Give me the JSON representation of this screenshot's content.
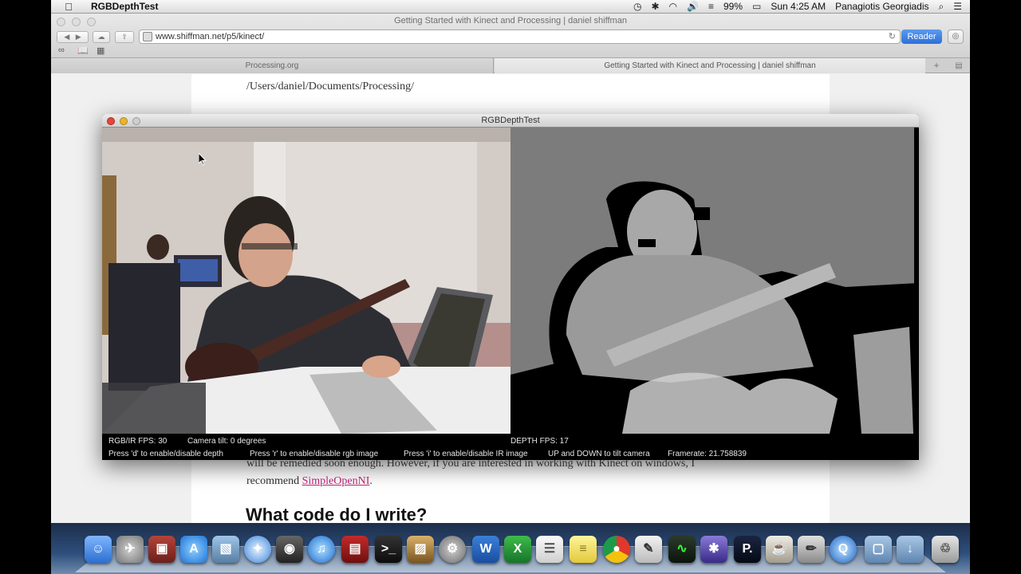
{
  "menubar": {
    "app_name": "RGBDepthTest",
    "battery": "99%",
    "clock": "Sun 4:25 AM",
    "user": "Panagiotis Georgiadis"
  },
  "safari": {
    "window_title": "Getting Started with Kinect and Processing | daniel shiffman",
    "url": "www.shiffman.net/p5/kinect/",
    "reader_label": "Reader",
    "tabs": [
      {
        "label": "Processing.org"
      },
      {
        "label": "Getting Started with Kinect and Processing | daniel shiffman"
      }
    ]
  },
  "page": {
    "path_text": "/Users/daniel/Documents/Processing/",
    "paragraph_partial": "will be remedied soon enough. However, if you are interested in working with Kinect on windows, I",
    "paragraph_recommend": "recommend ",
    "link_text": "SimpleOpenNI",
    "paragraph_end": ".",
    "heading": "What code do I write?"
  },
  "sketch": {
    "title": "RGBDepthTest",
    "rgb_fps": "RGB/IR FPS: 30",
    "camera_tilt": "Camera tilt: 0 degrees",
    "depth_fps": "DEPTH FPS: 17",
    "help_d": "Press 'd' to enable/disable depth",
    "help_r": "Press 'r' to enable/disable rgb image",
    "help_i": "Press 'i' to enable/disable IR image",
    "help_tilt": "UP and DOWN to tilt camera",
    "framerate": "Framerate: 21.758839"
  },
  "dock": {
    "icons": [
      "finder",
      "launchpad",
      "photo-booth",
      "app-store",
      "preview",
      "safari",
      "facetime",
      "itunes",
      "photo-slideshow",
      "terminal",
      "iphoto",
      "system-preferences",
      "word",
      "excel",
      "textedit",
      "stickies",
      "chrome",
      "script-editor",
      "activity-monitor",
      "instruments",
      "processing",
      "coffee",
      "pencil",
      "quicktime",
      "folder-applications",
      "folder-downloads",
      "trash"
    ]
  },
  "colors": {
    "reader_blue": "#3b82e6",
    "link_magenta": "#c0237a",
    "close_red": "#e4473b",
    "minimize_yellow": "#e8b530"
  }
}
